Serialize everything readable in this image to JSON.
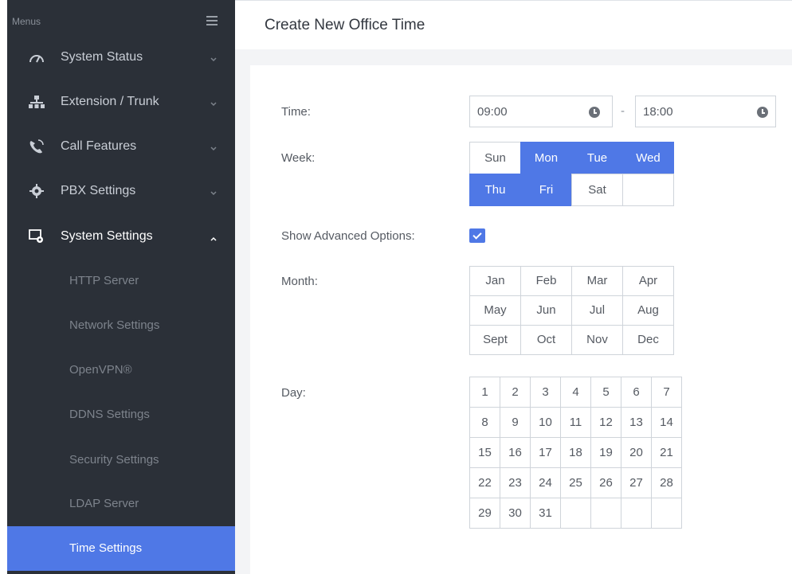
{
  "sidebar": {
    "menus_label": "Menus",
    "items": [
      {
        "label": "System Status",
        "icon": "gauge-icon",
        "expanded": false
      },
      {
        "label": "Extension / Trunk",
        "icon": "network-icon",
        "expanded": false
      },
      {
        "label": "Call Features",
        "icon": "phone-icon",
        "expanded": false
      },
      {
        "label": "PBX Settings",
        "icon": "gear-icon",
        "expanded": false
      },
      {
        "label": "System Settings",
        "icon": "settings-screen-icon",
        "expanded": true
      }
    ],
    "sub_items": [
      {
        "label": "HTTP Server"
      },
      {
        "label": "Network Settings"
      },
      {
        "label": "OpenVPN®"
      },
      {
        "label": "DDNS Settings"
      },
      {
        "label": "Security Settings"
      },
      {
        "label": "LDAP Server"
      },
      {
        "label": "Time Settings",
        "active": true
      }
    ]
  },
  "header": {
    "title": "Create New Office Time"
  },
  "form": {
    "time_label": "Time:",
    "time_start": "09:00",
    "time_separator": "-",
    "time_end": "18:00",
    "week_label": "Week:",
    "week_days": [
      {
        "label": "Sun",
        "selected": false
      },
      {
        "label": "Mon",
        "selected": true
      },
      {
        "label": "Tue",
        "selected": true
      },
      {
        "label": "Wed",
        "selected": true
      },
      {
        "label": "Thu",
        "selected": true
      },
      {
        "label": "Fri",
        "selected": true
      },
      {
        "label": "Sat",
        "selected": false
      }
    ],
    "advanced_label": "Show Advanced Options:",
    "advanced_checked": true,
    "month_label": "Month:",
    "months": [
      "Jan",
      "Feb",
      "Mar",
      "Apr",
      "May",
      "Jun",
      "Jul",
      "Aug",
      "Sept",
      "Oct",
      "Nov",
      "Dec"
    ],
    "day_label": "Day:",
    "days": [
      "1",
      "2",
      "3",
      "4",
      "5",
      "6",
      "7",
      "8",
      "9",
      "10",
      "11",
      "12",
      "13",
      "14",
      "15",
      "16",
      "17",
      "18",
      "19",
      "20",
      "21",
      "22",
      "23",
      "24",
      "25",
      "26",
      "27",
      "28",
      "29",
      "30",
      "31"
    ]
  },
  "colors": {
    "accent": "#4f78e6",
    "sidebar_bg": "#2b3038"
  }
}
